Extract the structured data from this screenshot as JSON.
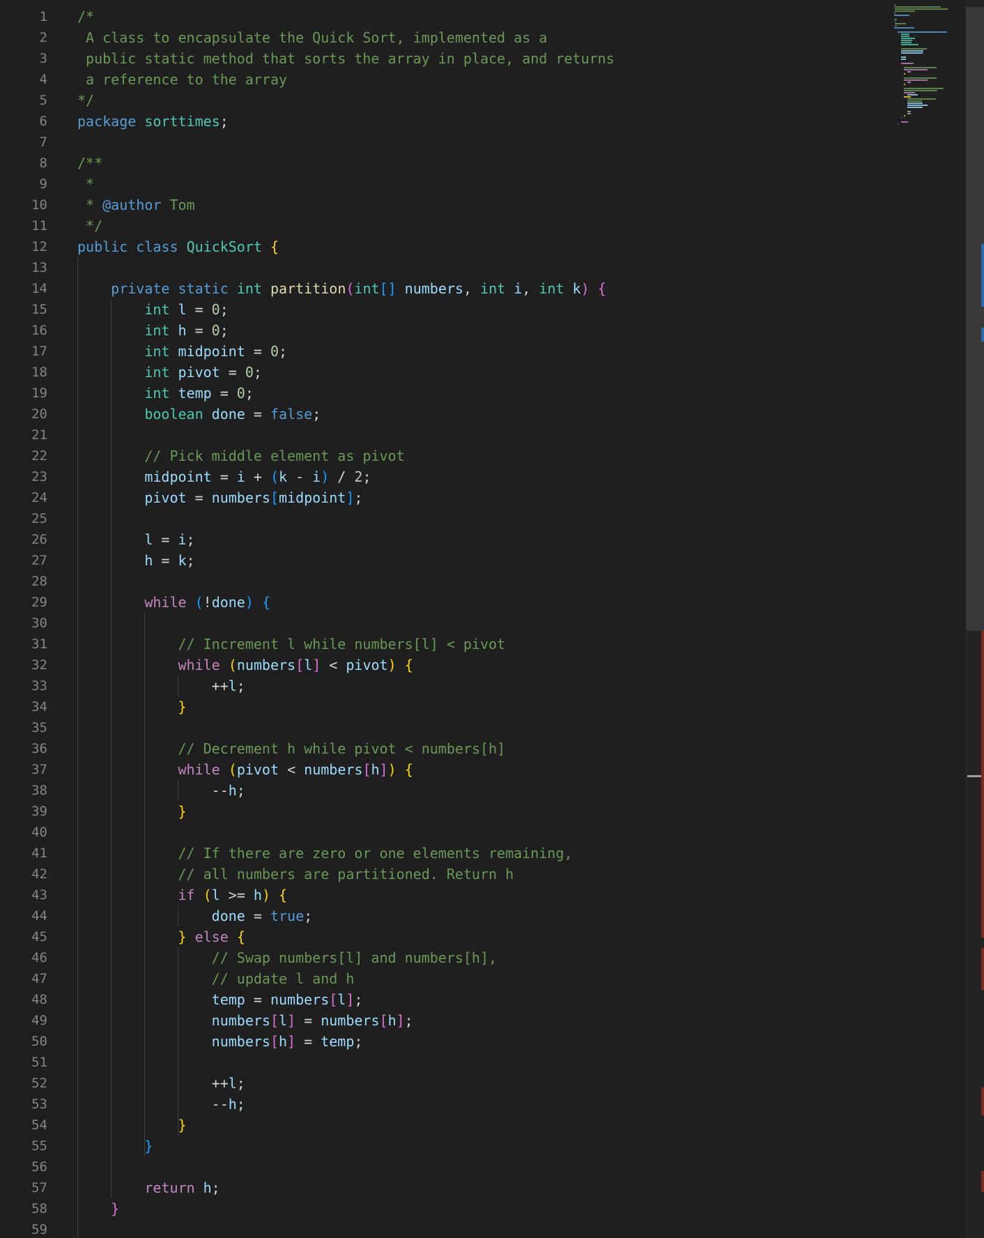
{
  "editor": {
    "colors": {
      "background": "#1f1f1f",
      "comment": "#6a9955",
      "keyword": "#569cd6",
      "control": "#c586c0",
      "type": "#4ec9b0",
      "function": "#dcdcaa",
      "variable": "#9cdcfe",
      "number": "#b5cea8",
      "bracket_1": "#ffd700",
      "bracket_2": "#da70d6",
      "bracket_3": "#179fff",
      "line_number": "#858585"
    },
    "lines": [
      [
        [
          "cm",
          "/*"
        ]
      ],
      [
        [
          "cm",
          " A class to encapsulate the Quick Sort, implemented as a"
        ]
      ],
      [
        [
          "cm",
          " public static method that sorts the array in place, and returns"
        ]
      ],
      [
        [
          "cm",
          " a reference to the array"
        ]
      ],
      [
        [
          "cm",
          "*/"
        ]
      ],
      [
        [
          "kw",
          "package"
        ],
        [
          "pl",
          " "
        ],
        [
          "cls",
          "sorttimes"
        ],
        [
          "pl",
          ";"
        ]
      ],
      [],
      [
        [
          "cm",
          "/**"
        ]
      ],
      [
        [
          "cm",
          " *"
        ]
      ],
      [
        [
          "cm",
          " * "
        ],
        [
          "doc",
          "@author"
        ],
        [
          "cm",
          " Tom"
        ]
      ],
      [
        [
          "cm",
          " */"
        ]
      ],
      [
        [
          "kw",
          "public"
        ],
        [
          "pl",
          " "
        ],
        [
          "kw",
          "class"
        ],
        [
          "pl",
          " "
        ],
        [
          "cls",
          "QuickSort"
        ],
        [
          "pl",
          " "
        ],
        [
          "b1",
          "{"
        ]
      ],
      [],
      [
        [
          "pl",
          "    "
        ],
        [
          "kw",
          "private"
        ],
        [
          "pl",
          " "
        ],
        [
          "kw",
          "static"
        ],
        [
          "pl",
          " "
        ],
        [
          "ty",
          "int"
        ],
        [
          "pl",
          " "
        ],
        [
          "fn",
          "partition"
        ],
        [
          "b2",
          "("
        ],
        [
          "ty",
          "int"
        ],
        [
          "b3",
          "[]"
        ],
        [
          "pl",
          " "
        ],
        [
          "var",
          "numbers"
        ],
        [
          "pl",
          ", "
        ],
        [
          "ty",
          "int"
        ],
        [
          "pl",
          " "
        ],
        [
          "var",
          "i"
        ],
        [
          "pl",
          ", "
        ],
        [
          "ty",
          "int"
        ],
        [
          "pl",
          " "
        ],
        [
          "var",
          "k"
        ],
        [
          "b2",
          ")"
        ],
        [
          "pl",
          " "
        ],
        [
          "b2",
          "{"
        ]
      ],
      [
        [
          "pl",
          "        "
        ],
        [
          "ty",
          "int"
        ],
        [
          "pl",
          " "
        ],
        [
          "var",
          "l"
        ],
        [
          "pl",
          " = "
        ],
        [
          "num",
          "0"
        ],
        [
          "pl",
          ";"
        ]
      ],
      [
        [
          "pl",
          "        "
        ],
        [
          "ty",
          "int"
        ],
        [
          "pl",
          " "
        ],
        [
          "var",
          "h"
        ],
        [
          "pl",
          " = "
        ],
        [
          "num",
          "0"
        ],
        [
          "pl",
          ";"
        ]
      ],
      [
        [
          "pl",
          "        "
        ],
        [
          "ty",
          "int"
        ],
        [
          "pl",
          " "
        ],
        [
          "var",
          "midpoint"
        ],
        [
          "pl",
          " = "
        ],
        [
          "num",
          "0"
        ],
        [
          "pl",
          ";"
        ]
      ],
      [
        [
          "pl",
          "        "
        ],
        [
          "ty",
          "int"
        ],
        [
          "pl",
          " "
        ],
        [
          "var",
          "pivot"
        ],
        [
          "pl",
          " = "
        ],
        [
          "num",
          "0"
        ],
        [
          "pl",
          ";"
        ]
      ],
      [
        [
          "pl",
          "        "
        ],
        [
          "ty",
          "int"
        ],
        [
          "pl",
          " "
        ],
        [
          "var",
          "temp"
        ],
        [
          "pl",
          " = "
        ],
        [
          "num",
          "0"
        ],
        [
          "pl",
          ";"
        ]
      ],
      [
        [
          "pl",
          "        "
        ],
        [
          "ty",
          "boolean"
        ],
        [
          "pl",
          " "
        ],
        [
          "var",
          "done"
        ],
        [
          "pl",
          " = "
        ],
        [
          "kw",
          "false"
        ],
        [
          "pl",
          ";"
        ]
      ],
      [],
      [
        [
          "pl",
          "        "
        ],
        [
          "cm",
          "// Pick middle element as pivot"
        ]
      ],
      [
        [
          "pl",
          "        "
        ],
        [
          "var",
          "midpoint"
        ],
        [
          "pl",
          " = "
        ],
        [
          "var",
          "i"
        ],
        [
          "pl",
          " + "
        ],
        [
          "b3",
          "("
        ],
        [
          "var",
          "k"
        ],
        [
          "pl",
          " - "
        ],
        [
          "var",
          "i"
        ],
        [
          "b3",
          ")"
        ],
        [
          "pl",
          " / "
        ],
        [
          "num",
          "2"
        ],
        [
          "pl",
          ";"
        ]
      ],
      [
        [
          "pl",
          "        "
        ],
        [
          "var",
          "pivot"
        ],
        [
          "pl",
          " = "
        ],
        [
          "var",
          "numbers"
        ],
        [
          "b3",
          "["
        ],
        [
          "var",
          "midpoint"
        ],
        [
          "b3",
          "]"
        ],
        [
          "pl",
          ";"
        ]
      ],
      [],
      [
        [
          "pl",
          "        "
        ],
        [
          "var",
          "l"
        ],
        [
          "pl",
          " = "
        ],
        [
          "var",
          "i"
        ],
        [
          "pl",
          ";"
        ]
      ],
      [
        [
          "pl",
          "        "
        ],
        [
          "var",
          "h"
        ],
        [
          "pl",
          " = "
        ],
        [
          "var",
          "k"
        ],
        [
          "pl",
          ";"
        ]
      ],
      [],
      [
        [
          "pl",
          "        "
        ],
        [
          "ctl",
          "while"
        ],
        [
          "pl",
          " "
        ],
        [
          "b3",
          "("
        ],
        [
          "pl",
          "!"
        ],
        [
          "var",
          "done"
        ],
        [
          "b3",
          ")"
        ],
        [
          "pl",
          " "
        ],
        [
          "b3",
          "{"
        ]
      ],
      [],
      [
        [
          "pl",
          "            "
        ],
        [
          "cm",
          "// Increment l while numbers[l] < pivot"
        ]
      ],
      [
        [
          "pl",
          "            "
        ],
        [
          "ctl",
          "while"
        ],
        [
          "pl",
          " "
        ],
        [
          "b1",
          "("
        ],
        [
          "var",
          "numbers"
        ],
        [
          "b2",
          "["
        ],
        [
          "var",
          "l"
        ],
        [
          "b2",
          "]"
        ],
        [
          "pl",
          " < "
        ],
        [
          "var",
          "pivot"
        ],
        [
          "b1",
          ")"
        ],
        [
          "pl",
          " "
        ],
        [
          "b1",
          "{"
        ]
      ],
      [
        [
          "pl",
          "                "
        ],
        [
          "pl",
          "++"
        ],
        [
          "var",
          "l"
        ],
        [
          "pl",
          ";"
        ]
      ],
      [
        [
          "pl",
          "            "
        ],
        [
          "b1",
          "}"
        ]
      ],
      [],
      [
        [
          "pl",
          "            "
        ],
        [
          "cm",
          "// Decrement h while pivot < numbers[h]"
        ]
      ],
      [
        [
          "pl",
          "            "
        ],
        [
          "ctl",
          "while"
        ],
        [
          "pl",
          " "
        ],
        [
          "b1",
          "("
        ],
        [
          "var",
          "pivot"
        ],
        [
          "pl",
          " < "
        ],
        [
          "var",
          "numbers"
        ],
        [
          "b2",
          "["
        ],
        [
          "var",
          "h"
        ],
        [
          "b2",
          "]"
        ],
        [
          "b1",
          ")"
        ],
        [
          "pl",
          " "
        ],
        [
          "b1",
          "{"
        ]
      ],
      [
        [
          "pl",
          "                "
        ],
        [
          "pl",
          "--"
        ],
        [
          "var",
          "h"
        ],
        [
          "pl",
          ";"
        ]
      ],
      [
        [
          "pl",
          "            "
        ],
        [
          "b1",
          "}"
        ]
      ],
      [],
      [
        [
          "pl",
          "            "
        ],
        [
          "cm",
          "// If there are zero or one elements remaining,"
        ]
      ],
      [
        [
          "pl",
          "            "
        ],
        [
          "cm",
          "// all numbers are partitioned. Return h"
        ]
      ],
      [
        [
          "pl",
          "            "
        ],
        [
          "ctl",
          "if"
        ],
        [
          "pl",
          " "
        ],
        [
          "b1",
          "("
        ],
        [
          "var",
          "l"
        ],
        [
          "pl",
          " >= "
        ],
        [
          "var",
          "h"
        ],
        [
          "b1",
          ")"
        ],
        [
          "pl",
          " "
        ],
        [
          "b1",
          "{"
        ]
      ],
      [
        [
          "pl",
          "                "
        ],
        [
          "var",
          "done"
        ],
        [
          "pl",
          " = "
        ],
        [
          "kw",
          "true"
        ],
        [
          "pl",
          ";"
        ]
      ],
      [
        [
          "pl",
          "            "
        ],
        [
          "b1",
          "}"
        ],
        [
          "pl",
          " "
        ],
        [
          "ctl",
          "else"
        ],
        [
          "pl",
          " "
        ],
        [
          "b1",
          "{"
        ]
      ],
      [
        [
          "pl",
          "                "
        ],
        [
          "cm",
          "// Swap numbers[l] and numbers[h],"
        ]
      ],
      [
        [
          "pl",
          "                "
        ],
        [
          "cm",
          "// update l and h"
        ]
      ],
      [
        [
          "pl",
          "                "
        ],
        [
          "var",
          "temp"
        ],
        [
          "pl",
          " = "
        ],
        [
          "var",
          "numbers"
        ],
        [
          "b2",
          "["
        ],
        [
          "var",
          "l"
        ],
        [
          "b2",
          "]"
        ],
        [
          "pl",
          ";"
        ]
      ],
      [
        [
          "pl",
          "                "
        ],
        [
          "var",
          "numbers"
        ],
        [
          "b2",
          "["
        ],
        [
          "var",
          "l"
        ],
        [
          "b2",
          "]"
        ],
        [
          "pl",
          " = "
        ],
        [
          "var",
          "numbers"
        ],
        [
          "b2",
          "["
        ],
        [
          "var",
          "h"
        ],
        [
          "b2",
          "]"
        ],
        [
          "pl",
          ";"
        ]
      ],
      [
        [
          "pl",
          "                "
        ],
        [
          "var",
          "numbers"
        ],
        [
          "b2",
          "["
        ],
        [
          "var",
          "h"
        ],
        [
          "b2",
          "]"
        ],
        [
          "pl",
          " = "
        ],
        [
          "var",
          "temp"
        ],
        [
          "pl",
          ";"
        ]
      ],
      [],
      [
        [
          "pl",
          "                "
        ],
        [
          "pl",
          "++"
        ],
        [
          "var",
          "l"
        ],
        [
          "pl",
          ";"
        ]
      ],
      [
        [
          "pl",
          "                "
        ],
        [
          "pl",
          "--"
        ],
        [
          "var",
          "h"
        ],
        [
          "pl",
          ";"
        ]
      ],
      [
        [
          "pl",
          "            "
        ],
        [
          "b1",
          "}"
        ]
      ],
      [
        [
          "pl",
          "        "
        ],
        [
          "b3",
          "}"
        ]
      ],
      [],
      [
        [
          "pl",
          "        "
        ],
        [
          "ctl",
          "return"
        ],
        [
          "pl",
          " "
        ],
        [
          "var",
          "h"
        ],
        [
          "pl",
          ";"
        ]
      ],
      [
        [
          "pl",
          "    "
        ],
        [
          "b2",
          "}"
        ]
      ],
      []
    ]
  }
}
